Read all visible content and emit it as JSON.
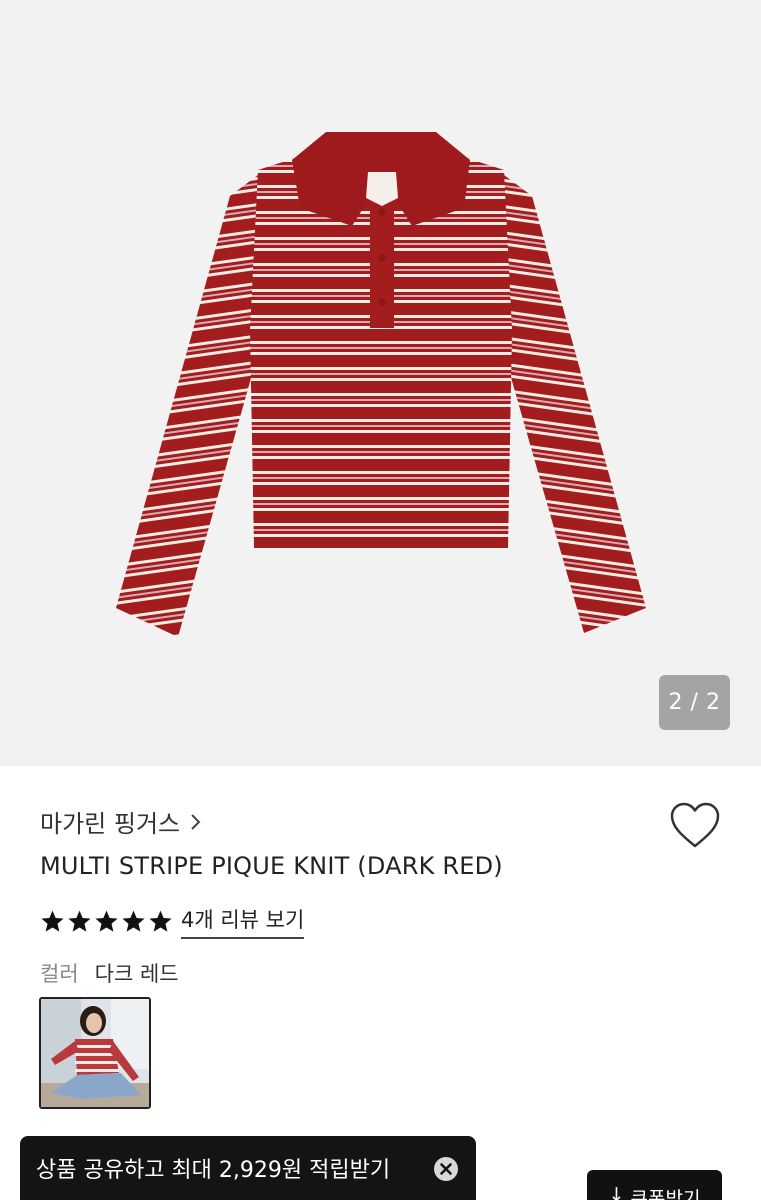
{
  "gallery": {
    "page_indicator": "2 / 2",
    "image_icon": "striped-polo-knit-sweater",
    "colors": {
      "background": "#f2f2f2",
      "knit_red": "#a31d1f",
      "stripe_cream": "#f3ece2",
      "stripe_pink": "#d9a9b4"
    }
  },
  "product": {
    "brand": "마가린 핑거스",
    "title": "MULTI STRIPE PIQUE KNIT (DARK RED)",
    "rating": 5,
    "review_link": "4개 리뷰 보기",
    "color_label": "컬러",
    "color_value": "다크 레드"
  },
  "icons": {
    "brand_chevron": "chevron-right-icon",
    "wishlist": "heart-outline-icon",
    "star": "star-filled-icon",
    "close": "close-circle-icon",
    "download": "arrow-down-icon"
  },
  "share_toast": {
    "text": "상품 공유하고 최대 2,929원 적립받기"
  },
  "coupon": {
    "label": "쿠폰받기",
    "arrow": "↓"
  }
}
